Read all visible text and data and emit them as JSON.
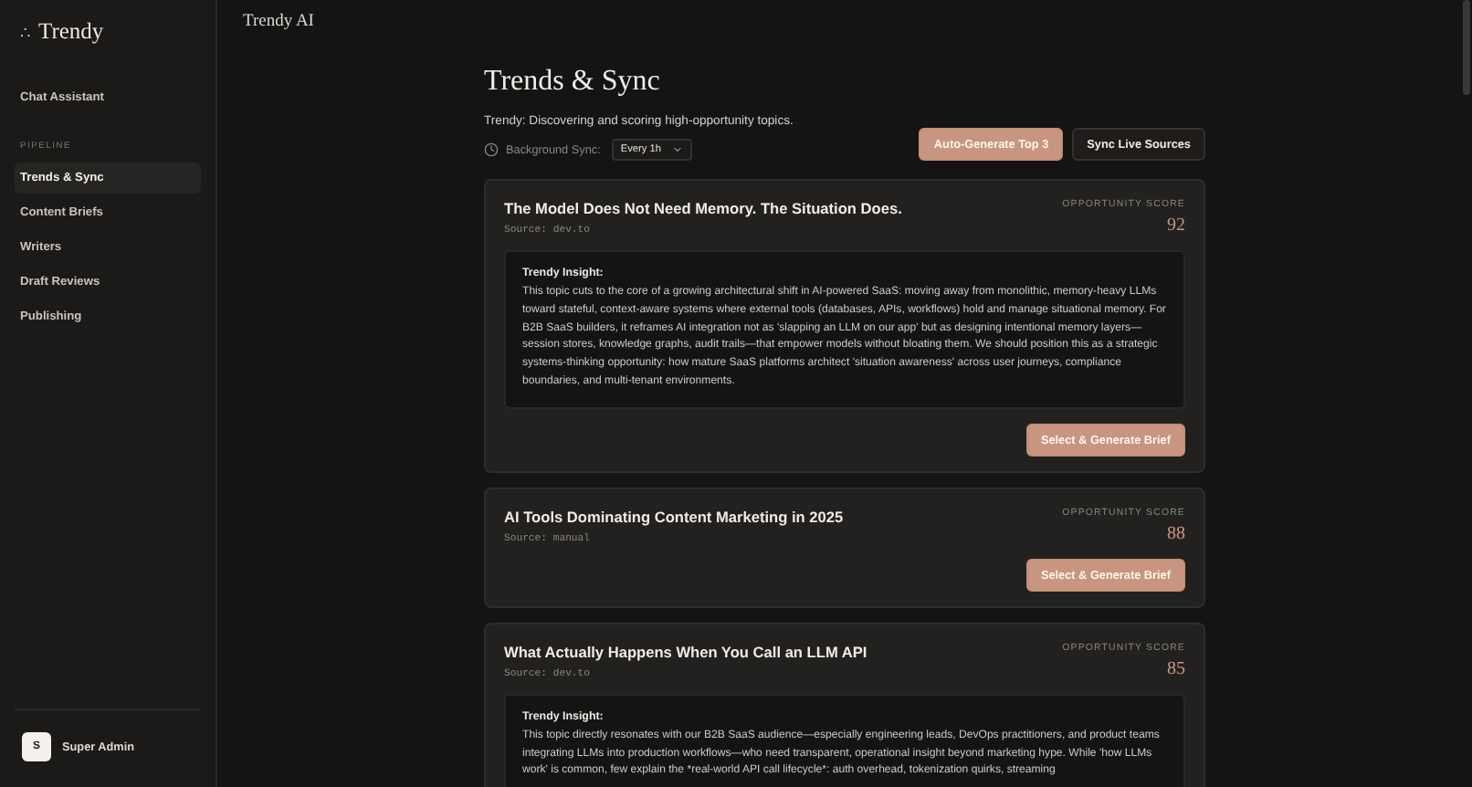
{
  "sidebar": {
    "logo_mark": "∴",
    "logo": "Trendy",
    "items": [
      {
        "kind": "link",
        "label": "Chat Assistant",
        "selected": false
      },
      {
        "kind": "section",
        "label": "PIPELINE"
      },
      {
        "kind": "link",
        "label": "Trends & Sync",
        "selected": true
      },
      {
        "kind": "link",
        "label": "Content Briefs",
        "selected": false
      },
      {
        "kind": "link",
        "label": "Writers",
        "selected": false
      },
      {
        "kind": "link",
        "label": "Draft Reviews",
        "selected": false
      },
      {
        "kind": "link",
        "label": "Publishing",
        "selected": false
      }
    ],
    "user": {
      "initial": "S",
      "name": "Super Admin"
    }
  },
  "header": {
    "title": "Trendy AI"
  },
  "page": {
    "title": "Trends & Sync",
    "subtitle": "Trendy: Discovering and scoring high-opportunity topics.",
    "sync_label": "Background Sync:",
    "sync_value": "Every 1h",
    "buttons": [
      {
        "kind": "primary",
        "label": "Auto-Generate Top 3"
      },
      {
        "kind": "secondary",
        "label": "Sync Live Sources"
      }
    ]
  },
  "topics": [
    {
      "title": "The Model Does Not Need Memory. The Situation Does.",
      "source": "Source: dev.to",
      "score_label": "OPPORTUNITY SCORE",
      "score": "92",
      "insight_label": "Trendy Insight:",
      "insight": "This topic cuts to the core of a growing architectural shift in AI-powered SaaS: moving away from monolithic, memory-heavy LLMs toward stateful, context-aware systems where external tools (databases, APIs, workflows) hold and manage situational memory. For B2B SaaS builders, it reframes AI integration not as 'slapping an LLM on our app' but as designing intentional memory layers—session stores, knowledge graphs, audit trails—that empower models without bloating them. We should position this as a strategic systems-thinking opportunity: how mature SaaS platforms architect 'situation awareness' across user journeys, compliance boundaries, and multi-tenant environments.",
      "action": "Select & Generate Brief"
    },
    {
      "title": "AI Tools Dominating Content Marketing in 2025",
      "source": "Source: manual",
      "score_label": "OPPORTUNITY SCORE",
      "score": "88",
      "action": "Select & Generate Brief"
    },
    {
      "title": "What Actually Happens When You Call an LLM API",
      "source": "Source: dev.to",
      "score_label": "OPPORTUNITY SCORE",
      "score": "85",
      "insight_label": "Trendy Insight:",
      "insight": "This topic directly resonates with our B2B SaaS audience—especially engineering leads, DevOps practitioners, and product teams integrating LLMs into production workflows—who need transparent, operational insight beyond marketing hype. While 'how LLMs work' is common, few explain the *real-world API call lifecycle*: auth overhead, tokenization quirks, streaming"
    }
  ]
}
